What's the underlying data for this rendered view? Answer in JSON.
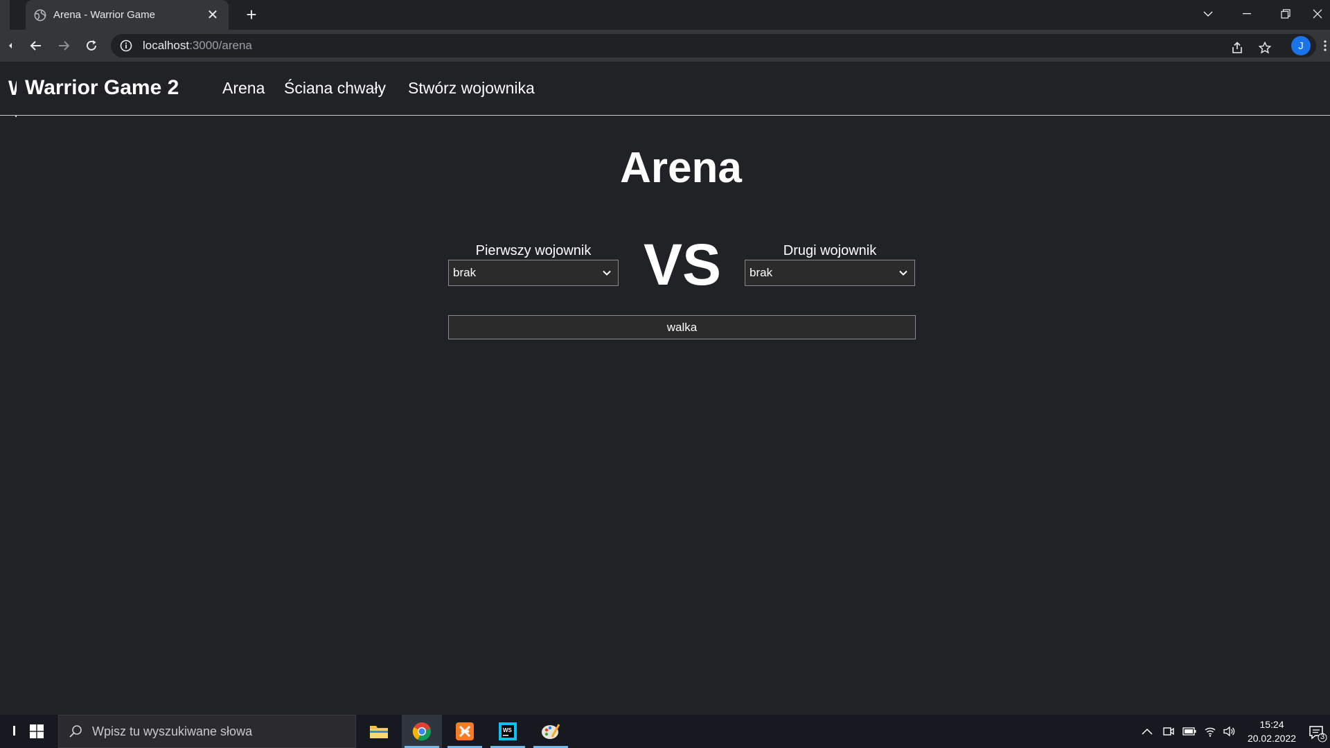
{
  "browser": {
    "tab_title": "Arena - Warrior Game",
    "url_host": "localhost",
    "url_rest": ":3000/arena",
    "profile_initial": "J"
  },
  "navbar": {
    "brand_cut": "W",
    "brand": "Warrior Game 2",
    "links": [
      "Arena",
      "Ściana chwały",
      "Stwórz wojownika"
    ]
  },
  "main": {
    "title": "Arena",
    "first_label": "Pierwszy wojownik",
    "first_value": "brak",
    "vs": "VS",
    "second_label": "Drugi wojownik",
    "second_value": "brak",
    "fight_button": "walka"
  },
  "taskbar": {
    "search_placeholder": "Wpisz tu wyszukiwane słowa",
    "time": "15:24",
    "date": "20.02.2022",
    "notification_count": "3"
  },
  "colors": {
    "page_bg": "#212226",
    "chrome_bg": "#35363a",
    "accent": "#1a73e8"
  }
}
